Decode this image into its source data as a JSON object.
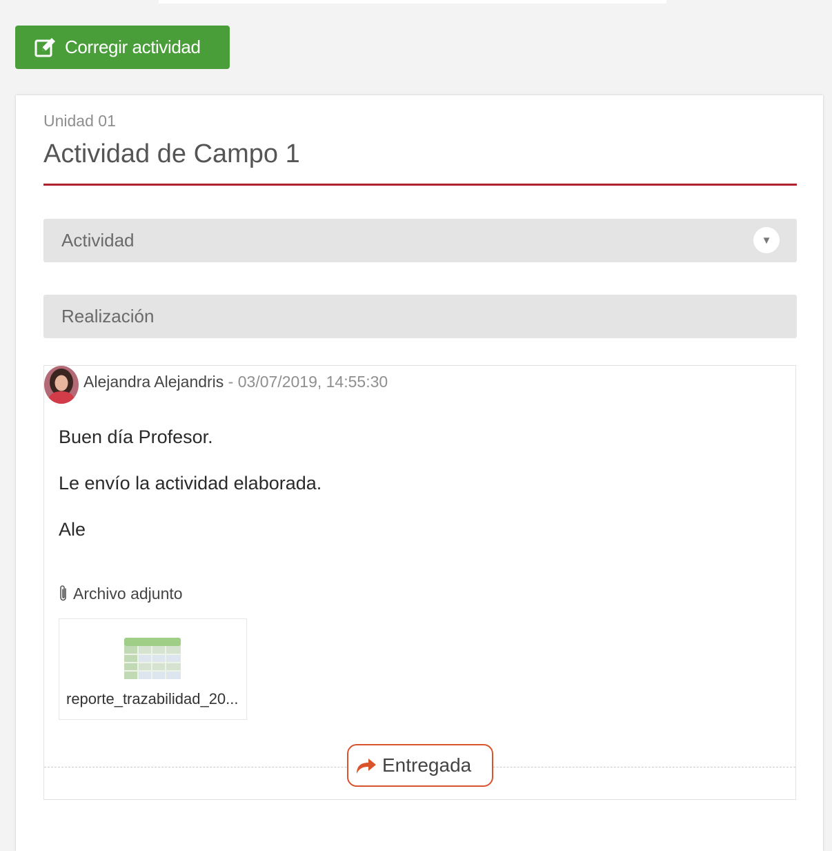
{
  "toolbar": {
    "correct_label": "Corregir actividad"
  },
  "activity": {
    "unit": "Unidad 01",
    "title": "Actividad de Campo 1"
  },
  "sections": {
    "activity_label": "Actividad",
    "realization_label": "Realización"
  },
  "post": {
    "author": "Alejandra Alejandris",
    "separator": " - ",
    "datetime": "03/07/2019, 14:55:30",
    "messages": [
      "Buen día Profesor.",
      "Le envío la actividad elaborada.",
      "Ale"
    ],
    "attachment_label": "Archivo adjunto",
    "attachment_filename": "reporte_trazabilidad_20...",
    "attachment_icon": "spreadsheet-icon",
    "status": "Entregada"
  },
  "colors": {
    "primary_green": "#4a9e3a",
    "title_underline": "#b0202c",
    "status_border": "#d9542b"
  }
}
